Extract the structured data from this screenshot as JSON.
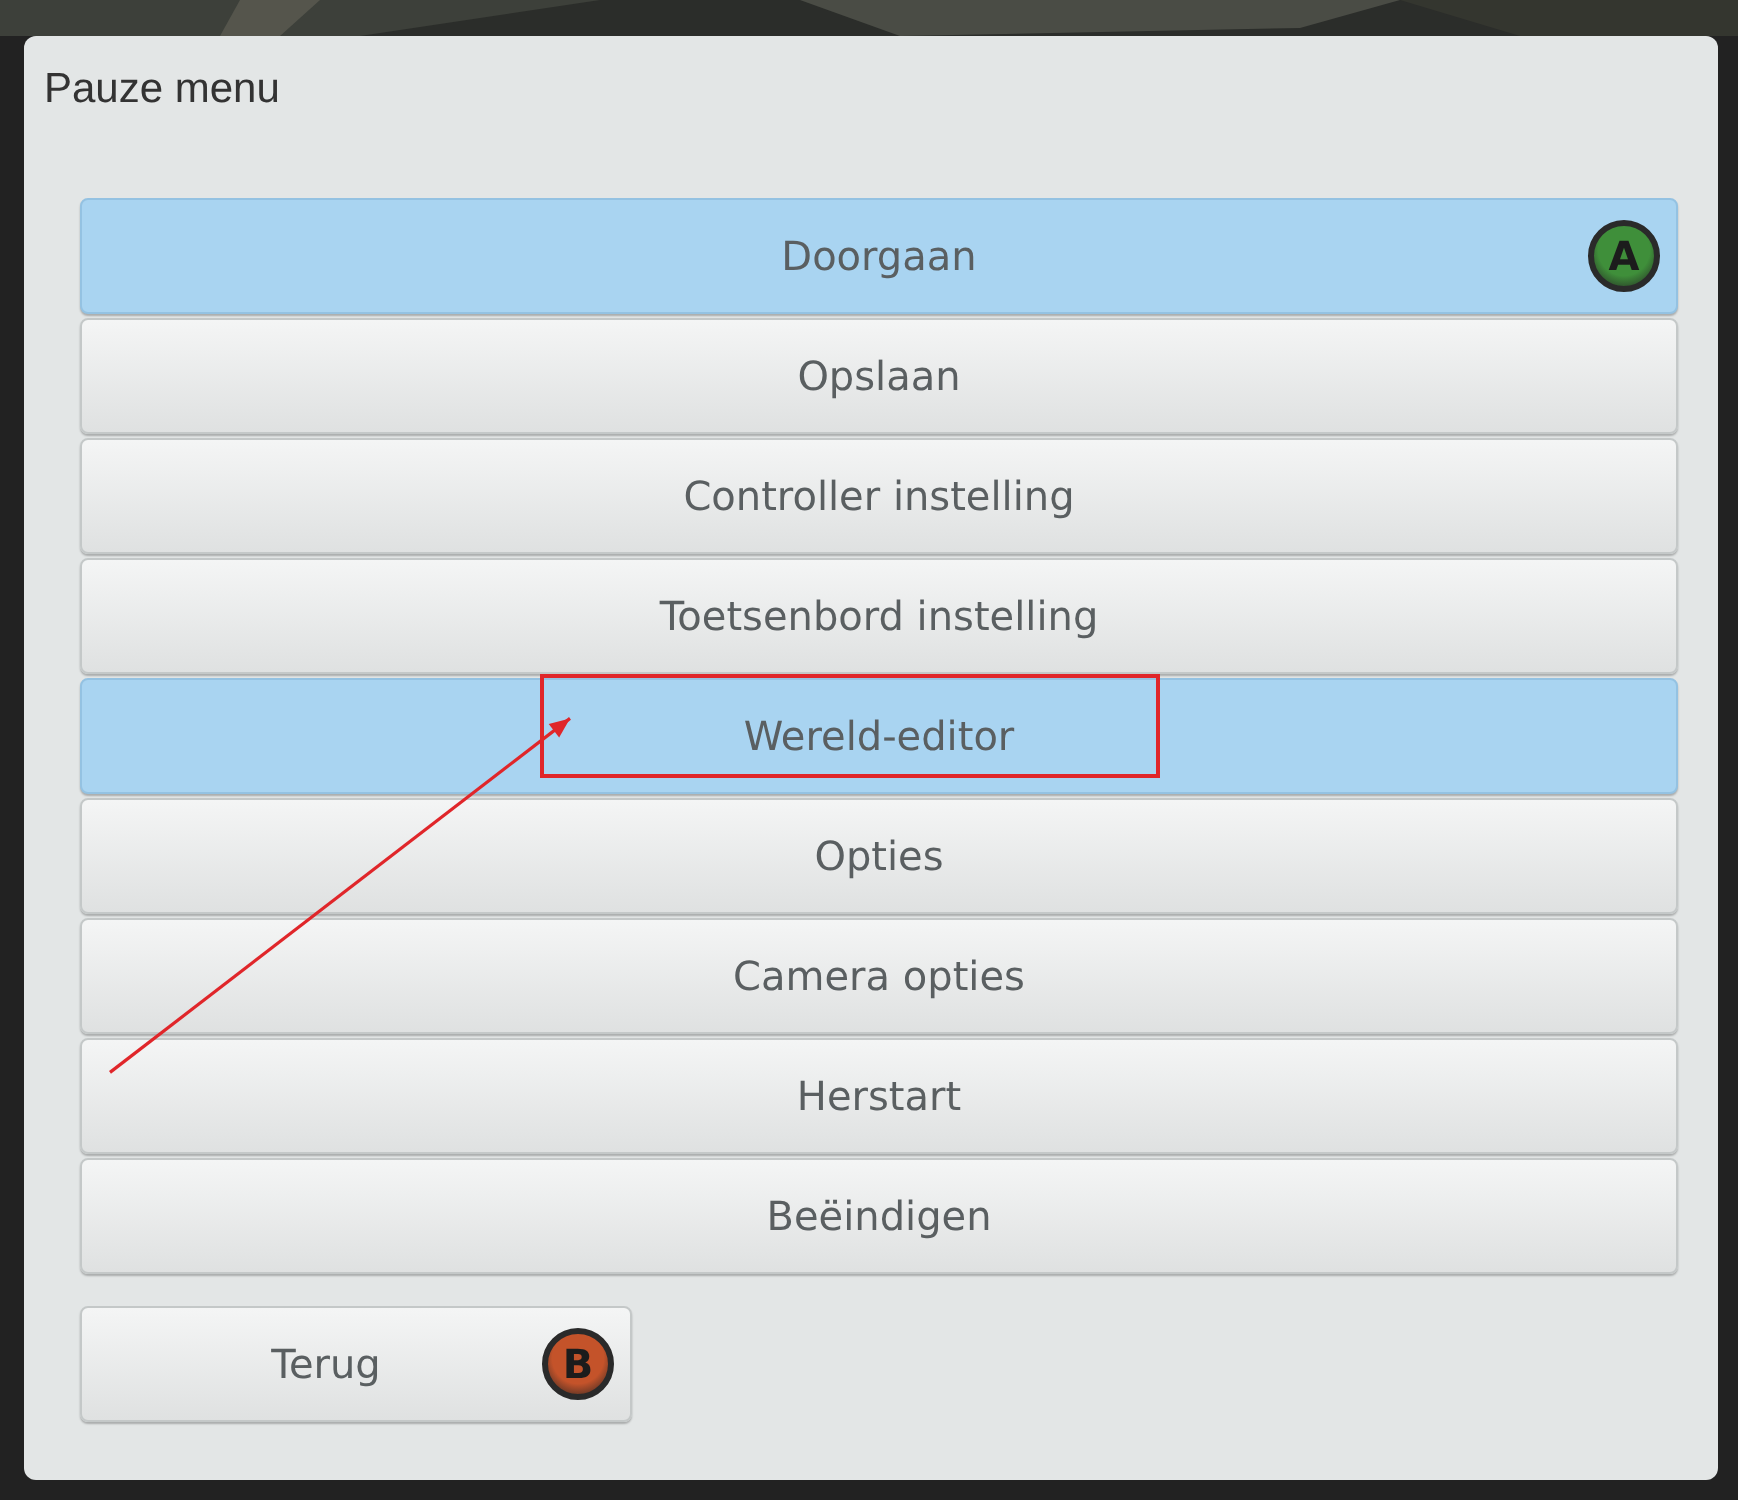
{
  "window": {
    "title": "Pauze menu"
  },
  "menu_items": [
    {
      "label": "Doorgaan",
      "selected": true,
      "annotated": false,
      "badge": {
        "letter": "A",
        "color": "#3f8f3a"
      }
    },
    {
      "label": "Opslaan",
      "selected": false,
      "annotated": false
    },
    {
      "label": "Controller instelling",
      "selected": false,
      "annotated": false
    },
    {
      "label": "Toetsenbord instelling",
      "selected": false,
      "annotated": false
    },
    {
      "label": "Wereld-editor",
      "selected": true,
      "annotated": true
    },
    {
      "label": "Opties",
      "selected": false,
      "annotated": false
    },
    {
      "label": "Camera opties",
      "selected": false,
      "annotated": false
    },
    {
      "label": "Herstart",
      "selected": false,
      "annotated": false
    },
    {
      "label": "Beëindigen",
      "selected": false,
      "annotated": false
    }
  ],
  "back_button": {
    "label": "Terug",
    "badge": {
      "letter": "B",
      "color": "#c4532a"
    }
  }
}
